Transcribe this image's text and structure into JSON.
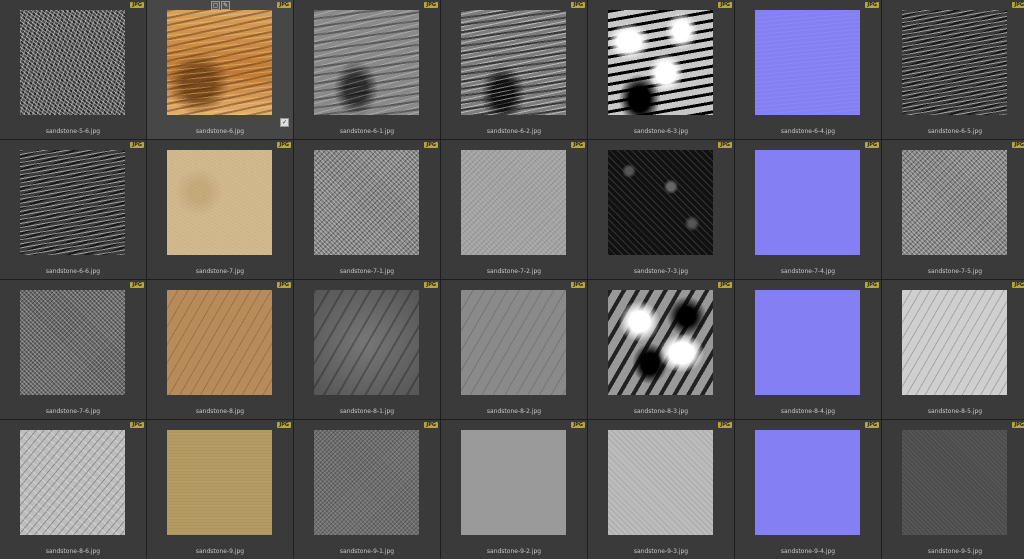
{
  "badge_label": "JPG",
  "tools": {
    "frame_icon": "frame-icon",
    "pencil_icon": "pencil-icon"
  },
  "selected_check_icon": "checkmark-icon",
  "files": [
    {
      "name": "sandstone-5-6.jpg",
      "texture": "noise"
    },
    {
      "name": "sandstone-6.jpg",
      "texture": "orange",
      "selected": true
    },
    {
      "name": "sandstone-6-1.jpg",
      "texture": "gray-streak"
    },
    {
      "name": "sandstone-6-2.jpg",
      "texture": "gray-streak-contrast"
    },
    {
      "name": "sandstone-6-3.jpg",
      "texture": "bw-high"
    },
    {
      "name": "sandstone-6-4.jpg",
      "texture": "normal-wave"
    },
    {
      "name": "sandstone-6-5.jpg",
      "texture": "dark-streak"
    },
    {
      "name": "sandstone-6-6.jpg",
      "texture": "dark-streak"
    },
    {
      "name": "sandstone-7.jpg",
      "texture": "beige"
    },
    {
      "name": "sandstone-7-1.jpg",
      "texture": "gray-speckle"
    },
    {
      "name": "sandstone-7-2.jpg",
      "texture": "gray-light"
    },
    {
      "name": "sandstone-7-3.jpg",
      "texture": "black-speckle"
    },
    {
      "name": "sandstone-7-4.jpg",
      "texture": "normal"
    },
    {
      "name": "sandstone-7-5.jpg",
      "texture": "gray-speckle"
    },
    {
      "name": "sandstone-7-6.jpg",
      "texture": "gray-mid"
    },
    {
      "name": "sandstone-8.jpg",
      "texture": "tan"
    },
    {
      "name": "sandstone-8-1.jpg",
      "texture": "gray-soft"
    },
    {
      "name": "sandstone-8-2.jpg",
      "texture": "gray-flat"
    },
    {
      "name": "sandstone-8-3.jpg",
      "texture": "bw-blotch"
    },
    {
      "name": "sandstone-8-4.jpg",
      "texture": "normal"
    },
    {
      "name": "sandstone-8-5.jpg",
      "texture": "light-relief"
    },
    {
      "name": "sandstone-8-6.jpg",
      "texture": "light-relief2"
    },
    {
      "name": "sandstone-9.jpg",
      "texture": "khaki"
    },
    {
      "name": "sandstone-9-1.jpg",
      "texture": "gray-grain"
    },
    {
      "name": "sandstone-9-2.jpg",
      "texture": "gray-smooth"
    },
    {
      "name": "sandstone-9-3.jpg",
      "texture": "gray-pale"
    },
    {
      "name": "sandstone-9-4.jpg",
      "texture": "normal"
    },
    {
      "name": "sandstone-9-5.jpg",
      "texture": "gray-dark-grain"
    }
  ]
}
